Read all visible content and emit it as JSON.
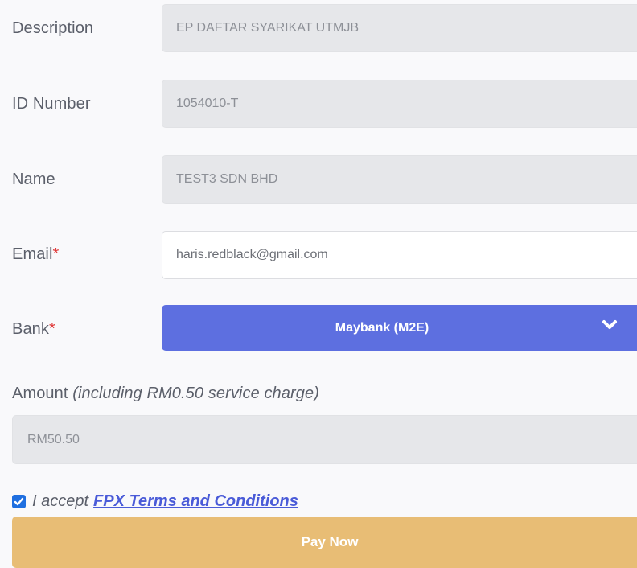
{
  "form": {
    "description": {
      "label": "Description",
      "value": "EP DAFTAR SYARIKAT UTMJB"
    },
    "id_number": {
      "label": "ID Number",
      "value": "1054010-T"
    },
    "name": {
      "label": "Name",
      "value": "TEST3 SDN BHD"
    },
    "email": {
      "label": "Email",
      "required_mark": "*",
      "value": "haris.redblack@gmail.com"
    },
    "bank": {
      "label": "Bank",
      "required_mark": "*",
      "selected": "Maybank (M2E)"
    },
    "amount": {
      "label": "Amount",
      "note": "(including RM0.50 service charge)",
      "value": "RM50.50"
    }
  },
  "terms": {
    "checked": true,
    "text": "I accept",
    "link_label": "FPX Terms and Conditions"
  },
  "pay_button": {
    "label": "Pay Now"
  },
  "colors": {
    "bank_select": "#5d6fe0",
    "pay_button": "#e8bd75",
    "required": "#e03a3a",
    "link": "#4a5bd8",
    "checkbox": "#1f6fe0"
  },
  "icons": {
    "bank_dropdown": "chevron-down-icon",
    "terms_checkbox": "check-icon"
  }
}
